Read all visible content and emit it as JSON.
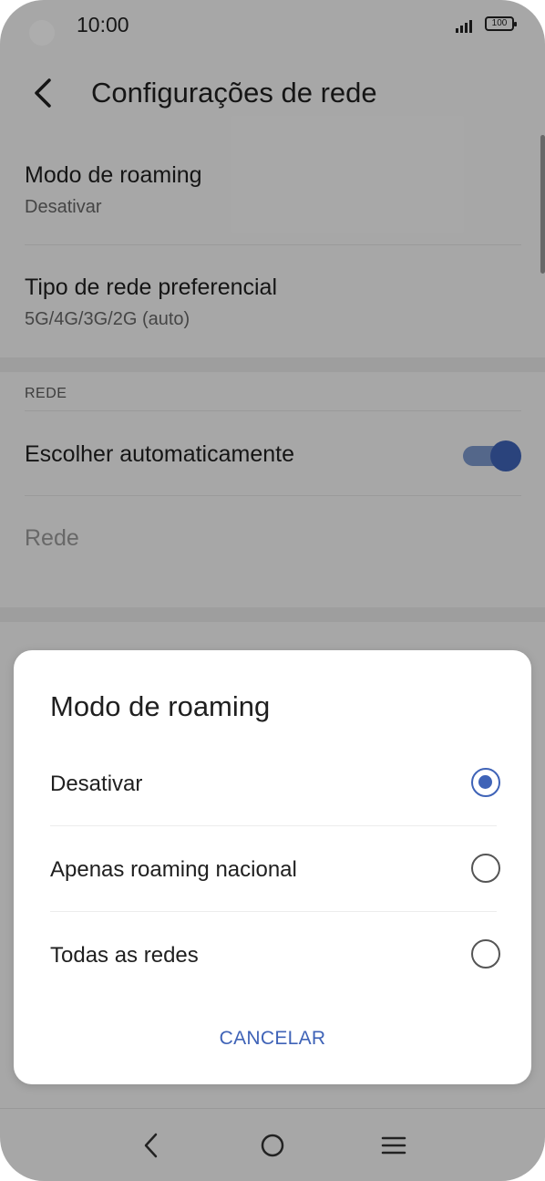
{
  "status_bar": {
    "time": "10:00",
    "battery": "100"
  },
  "app_bar": {
    "title": "Configurações de rede"
  },
  "settings": {
    "roaming": {
      "label": "Modo de roaming",
      "value": "Desativar"
    },
    "network_type": {
      "label": "Tipo de rede preferencial",
      "value": "5G/4G/3G/2G (auto)"
    },
    "section_network": {
      "header": "REDE"
    },
    "auto_select": {
      "label": "Escolher automaticamente",
      "enabled": true
    },
    "network": {
      "label": "Rede"
    }
  },
  "dialog": {
    "title": "Modo de roaming",
    "options": [
      {
        "label": "Desativar",
        "selected": true
      },
      {
        "label": "Apenas roaming nacional",
        "selected": false
      },
      {
        "label": "Todas as redes",
        "selected": false
      }
    ],
    "cancel_label": "CANCELAR"
  },
  "colors": {
    "accent": "#3f63b7",
    "toggle_track": "#7c98cc",
    "scrim": "rgba(0,0,0,0.32)"
  },
  "icons": {
    "back": "chevron-left-icon",
    "nav_back": "nav-back-icon",
    "nav_home": "nav-home-icon",
    "nav_recents": "nav-recents-icon"
  }
}
